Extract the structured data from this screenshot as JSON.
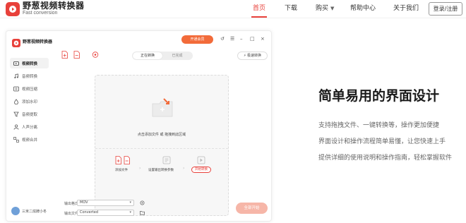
{
  "brand": {
    "name": "野葱视频转换器",
    "subtitle": "Fast conversion",
    "color": "#e8413b"
  },
  "nav": {
    "items": [
      {
        "label": "首页",
        "active": true
      },
      {
        "label": "下载",
        "active": false
      },
      {
        "label": "购买",
        "active": false,
        "dropdown": true
      },
      {
        "label": "帮助中心",
        "active": false
      },
      {
        "label": "关于我们",
        "active": false
      }
    ],
    "login_label": "登录/注册"
  },
  "app": {
    "title": "野葱视频转换器",
    "vip_label": "开通会员",
    "fast_convert_label": "极速转换",
    "sidebar": [
      {
        "label": "视频转换",
        "icon": "video-convert-icon",
        "active": true
      },
      {
        "label": "音频转换",
        "icon": "audio-convert-icon",
        "active": false
      },
      {
        "label": "视频压缩",
        "icon": "video-compress-icon",
        "active": false
      },
      {
        "label": "添加水印",
        "icon": "watermark-icon",
        "active": false
      },
      {
        "label": "音频提取",
        "icon": "audio-extract-icon",
        "active": false
      },
      {
        "label": "人声分离",
        "icon": "voice-separate-icon",
        "active": false
      },
      {
        "label": "视频合并",
        "icon": "video-merge-icon",
        "active": false
      }
    ],
    "user_name": "三米二炫牌小冬",
    "tabs": [
      {
        "label": "正在转换",
        "active": true
      },
      {
        "label": "已完成",
        "active": false
      }
    ],
    "drop_hint": "点击添加文件 或 拖拽到此区域",
    "steps": [
      {
        "label": "添加文件"
      },
      {
        "label": "设置输出转换参数"
      },
      {
        "label": "开始转换"
      }
    ],
    "output_format_label": "输出格式:",
    "output_format_value": "MOV",
    "output_folder_label": "输出文件夹:",
    "output_folder_value": "Converted",
    "convert_all_label": "全部开始"
  },
  "marketing": {
    "headline": "简单易用的界面设计",
    "lines": [
      "支持拖拽文件、一键转换等，操作更加便捷",
      "界面设计和操作流程简单易懂，让您快速上手",
      "提供详细的使用说明和操作指南，轻松掌握软件"
    ]
  }
}
